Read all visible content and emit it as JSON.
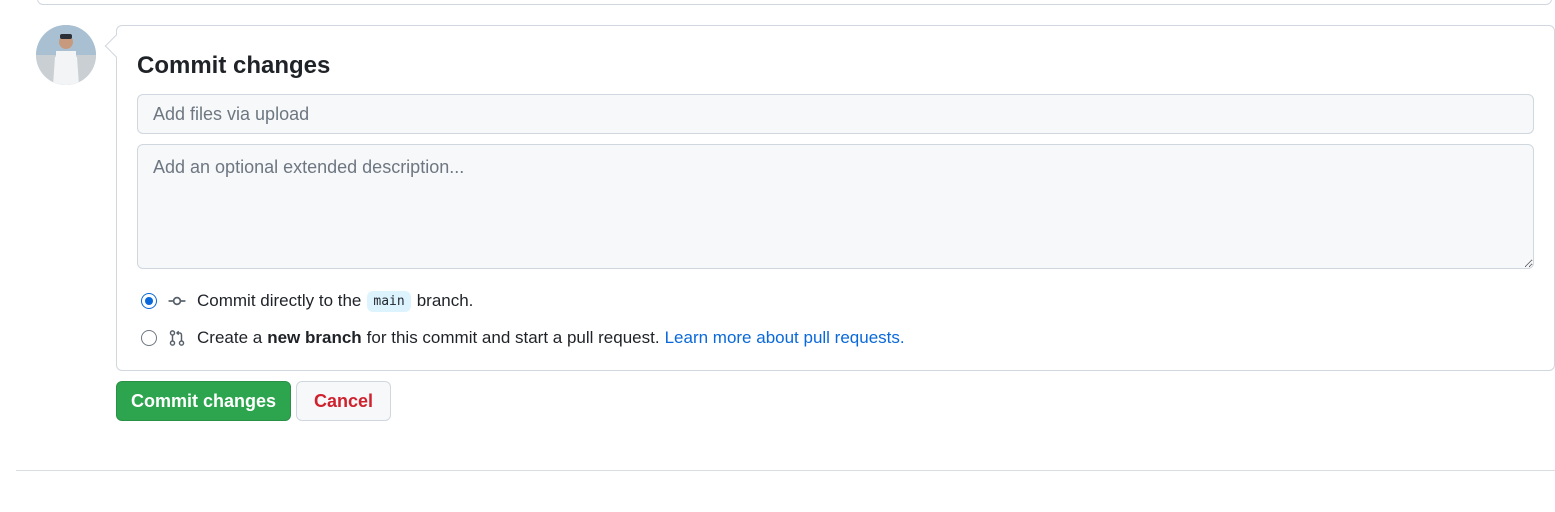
{
  "form": {
    "title": "Commit changes",
    "summary_placeholder": "Add files via upload",
    "description_placeholder": "Add an optional extended description..."
  },
  "options": {
    "direct": {
      "selected": true,
      "text_before": "Commit directly to the",
      "branch": "main",
      "text_after": "branch."
    },
    "new_branch": {
      "selected": false,
      "text_before": "Create a",
      "bold": "new branch",
      "text_after": "for this commit and start a pull request.",
      "link": "Learn more about pull requests."
    }
  },
  "actions": {
    "commit_label": "Commit changes",
    "cancel_label": "Cancel"
  },
  "icons": {
    "direct": "git-commit-icon",
    "new_branch": "git-pull-request-icon"
  },
  "colors": {
    "primary_button": "#2da44e",
    "cancel_text": "#cf222e",
    "link": "#0969da",
    "radio_selected": "#0969da"
  }
}
